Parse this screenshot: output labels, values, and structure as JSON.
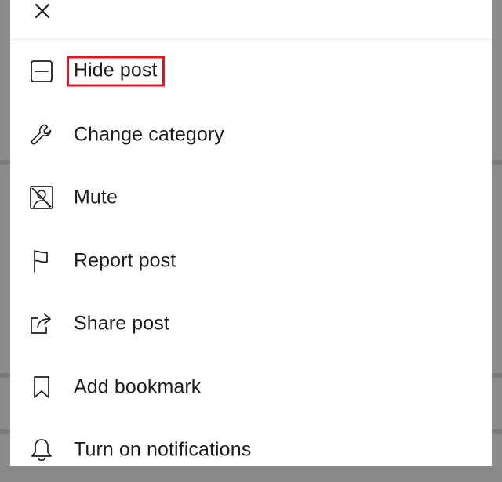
{
  "header": {
    "close_icon": "close-icon"
  },
  "menu": {
    "items": [
      {
        "label": "Hide post",
        "icon": "hide-icon",
        "highlighted": true
      },
      {
        "label": "Change category",
        "icon": "wrench-icon"
      },
      {
        "label": "Mute",
        "icon": "mute-icon"
      },
      {
        "label": "Report post",
        "icon": "flag-icon"
      },
      {
        "label": "Share post",
        "icon": "share-icon"
      },
      {
        "label": "Add bookmark",
        "icon": "bookmark-icon"
      },
      {
        "label": "Turn on notifications",
        "icon": "bell-icon"
      }
    ]
  },
  "colors": {
    "highlight": "#e0141e",
    "text": "#1c1c1c",
    "backdrop": "#8c8c8c"
  }
}
